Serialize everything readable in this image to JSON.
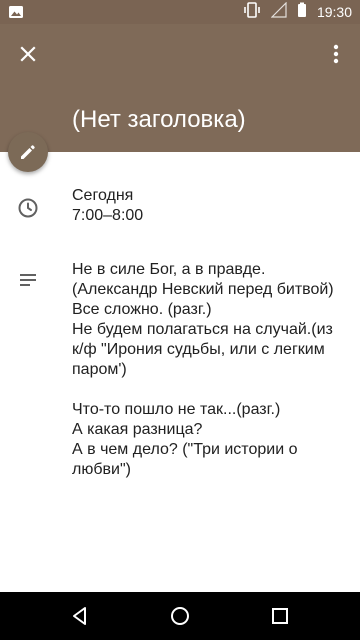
{
  "status_bar": {
    "time": "19:30",
    "icons": [
      "image-icon",
      "vibrate-icon",
      "signal-icon",
      "battery-icon"
    ]
  },
  "header": {
    "title": "(Нет заголовка)",
    "icons": {
      "close": "close-icon",
      "overflow": "more-vert-icon"
    },
    "background_color": "#7f6a58"
  },
  "fab": {
    "icon": "edit-icon",
    "color": "#7c6a57"
  },
  "event": {
    "date_label": "Сегодня",
    "time_range": "7:00–8:00",
    "description": "Не в силе Бог, а в правде.\n(Александр Невский перед битвой)\nВсе сложно. (разг.)\nНе будем полагаться на случай.(из к/ф \"Ирония судьбы, или с легким паром')\n\nЧто-то пошло не так...(разг.)\nА какая разница?\nА в чем дело? (\"Три истории о любви\")"
  },
  "nav_bar": {
    "icons": [
      "back-icon",
      "home-icon",
      "recents-icon"
    ]
  }
}
